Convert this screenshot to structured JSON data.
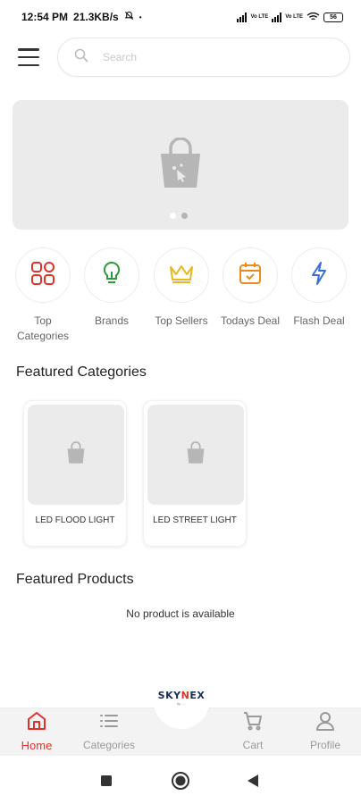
{
  "status_bar": {
    "time": "12:54 PM",
    "speed": "21.3KB/s",
    "volte1": "Vo LTE",
    "volte2": "Vo LTE",
    "battery": "56"
  },
  "search": {
    "placeholder": "Search"
  },
  "banner": {
    "slides": 2,
    "active_slide": 2
  },
  "quick_categories": [
    {
      "label": "Top Categories",
      "icon": "grid-icon",
      "color": "#e0322a"
    },
    {
      "label": "Brands",
      "icon": "bulb-icon",
      "color": "#2e9b3a"
    },
    {
      "label": "Top Sellers",
      "icon": "crown-icon",
      "color": "#e8b81e"
    },
    {
      "label": "Todays Deal",
      "icon": "calendar-icon",
      "color": "#ee8a1b"
    },
    {
      "label": "Flash Deal",
      "icon": "lightning-icon",
      "color": "#3a6fd8"
    }
  ],
  "featured_categories": {
    "title": "Featured Categories",
    "items": [
      {
        "name": "LED FLOOD LIGHT"
      },
      {
        "name": "LED STREET LIGHT"
      }
    ]
  },
  "featured_products": {
    "title": "Featured Products",
    "empty_message": "No product is available"
  },
  "bottom_nav": {
    "items": [
      {
        "label": "Home",
        "icon": "home-icon",
        "active": true
      },
      {
        "label": "Categories",
        "icon": "list-icon",
        "active": false
      },
      {
        "label": "Cart",
        "icon": "cart-icon",
        "active": false
      },
      {
        "label": "Profile",
        "icon": "person-icon",
        "active": false
      }
    ],
    "logo": {
      "text_a": "SKY",
      "text_x": "N",
      "text_b": "EX",
      "tagline": "by ....."
    }
  },
  "colors": {
    "accent": "#e0322a",
    "placeholder_bg": "#ebebeb"
  }
}
